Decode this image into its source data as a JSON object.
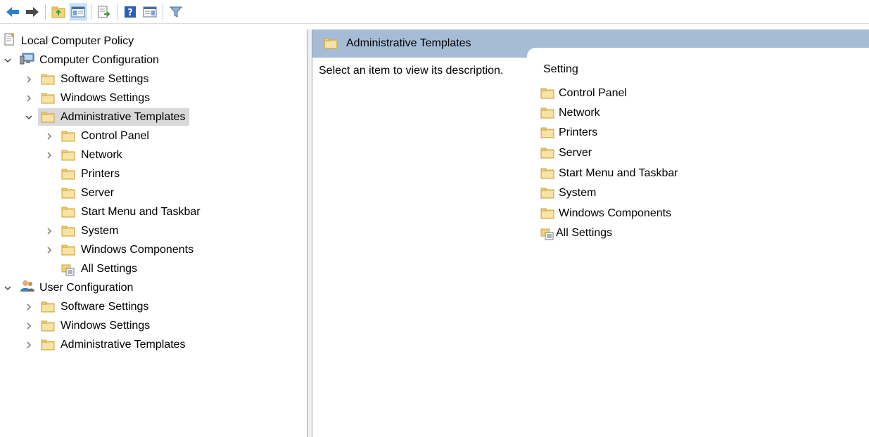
{
  "toolbar": {
    "buttons": [
      {
        "name": "back-arrow-icon"
      },
      {
        "name": "forward-arrow-icon"
      },
      {
        "name": "up-folder-icon"
      },
      {
        "name": "show-hide-console-tree-icon"
      },
      {
        "name": "export-list-icon"
      },
      {
        "name": "help-icon"
      },
      {
        "name": "show-hide-action-pane-icon"
      },
      {
        "name": "filter-icon"
      }
    ]
  },
  "tree": {
    "root": "Local Computer Policy",
    "computer_config": "Computer Configuration",
    "cc_software": "Software Settings",
    "cc_windows": "Windows Settings",
    "cc_admin": "Administrative Templates",
    "at_control_panel": "Control Panel",
    "at_network": "Network",
    "at_printers": "Printers",
    "at_server": "Server",
    "at_start_menu": "Start Menu and Taskbar",
    "at_system": "System",
    "at_windows_components": "Windows Components",
    "at_all_settings": "All Settings",
    "user_config": "User Configuration",
    "uc_software": "Software Settings",
    "uc_windows": "Windows Settings",
    "uc_admin": "Administrative Templates"
  },
  "right_pane": {
    "title": "Administrative Templates",
    "description": "Select an item to view its description.",
    "column_header": "Setting",
    "items": [
      "Control Panel",
      "Network",
      "Printers",
      "Server",
      "Start Menu and Taskbar",
      "System",
      "Windows Components",
      "All Settings"
    ]
  },
  "colors": {
    "header_band": "#a6bcd6",
    "selection": "#d9d9d9",
    "folder": "#f3d27a"
  }
}
